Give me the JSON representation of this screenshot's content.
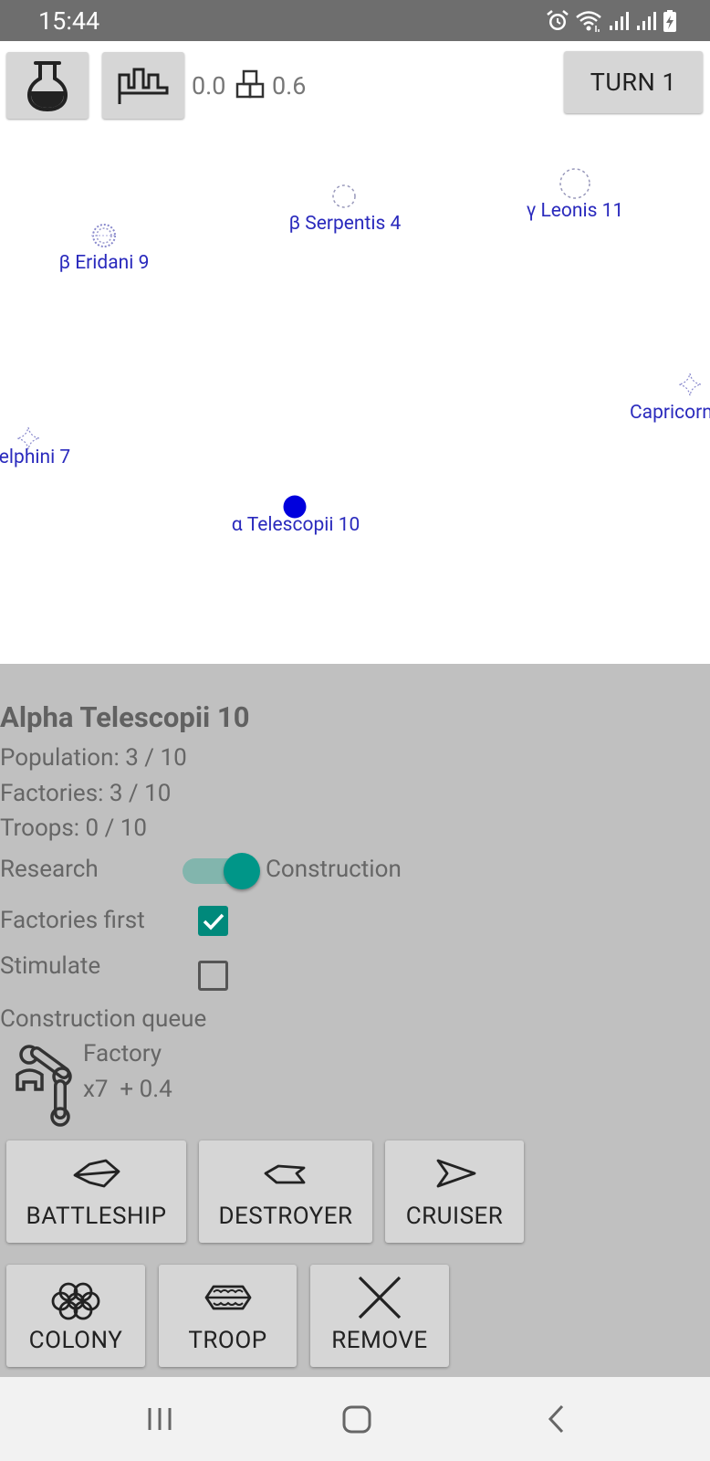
{
  "status_bar": {
    "time": "15:44",
    "icons": [
      "alarm-icon",
      "wifi-icon",
      "signal-icon",
      "signal-icon",
      "battery-charging-icon"
    ]
  },
  "toolbar": {
    "research_button_icon": "flask-icon",
    "production_button_icon": "factories-icon",
    "research_value": "0.0",
    "construction_icon": "blocks-icon",
    "construction_value": "0.6",
    "turn_label": "TURN 1"
  },
  "map": {
    "stars": [
      {
        "label": "β Eridani 9",
        "marker": "dotted-circle-icon"
      },
      {
        "label": "β Serpentis 4",
        "marker": "dashed-circle-icon"
      },
      {
        "label": "γ Leonis 11",
        "marker": "dashed-circle-icon"
      },
      {
        "label": "elphini 7",
        "marker": "diamond-star-icon"
      },
      {
        "label": "α Telescopii 10",
        "marker": "owned-planet-icon"
      },
      {
        "label": "Capricorn",
        "marker": "diamond-star-icon"
      }
    ]
  },
  "colors": {
    "owned_planet": "#0000dd",
    "star_label": "#2a2abd",
    "accent": "#009688",
    "panel_bg": "#c0c0c0"
  },
  "panel": {
    "title": "Alpha Telescopii 10",
    "population": "Population: 3 / 10",
    "factories": "Factories: 3 / 10",
    "troops": "Troops: 0 / 10",
    "toggle_left_label": "Research",
    "toggle_right_label": "Construction",
    "toggle_on": true,
    "factories_first_label": "Factories first",
    "factories_first_checked": true,
    "stimulate_label": "Stimulate",
    "stimulate_checked": false,
    "queue_heading": "Construction queue",
    "queue_item": {
      "icon": "robot-arm-icon",
      "name": "Factory",
      "detail": "x7  + 0.4"
    }
  },
  "buttons": {
    "battleship": "BATTLESHIP",
    "destroyer": "DESTROYER",
    "cruiser": "CRUISER",
    "colony": "COLONY",
    "troop": "TROOP",
    "remove": "REMOVE"
  },
  "nav_bar": {
    "icons": [
      "recents-icon",
      "home-icon",
      "back-icon"
    ]
  }
}
